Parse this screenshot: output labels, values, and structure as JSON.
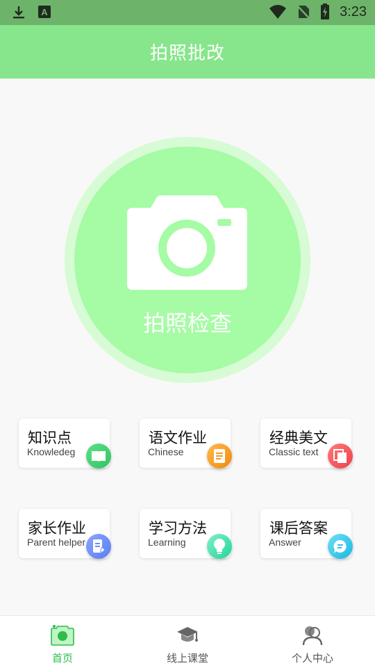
{
  "status_bar": {
    "time": "3:23",
    "icons": [
      "download-icon",
      "a11y-app-icon",
      "wifi-icon",
      "no-sim-icon",
      "battery-charging-icon"
    ]
  },
  "header": {
    "title": "拍照批改"
  },
  "camera": {
    "label": "拍照检查",
    "icon": "camera-icon"
  },
  "cards": [
    {
      "title": "知识点",
      "subtitle": "Knowledeg",
      "icon": "book-icon",
      "color": "#3ecf6a"
    },
    {
      "title": "语文作业",
      "subtitle": "Chinese",
      "icon": "note-icon",
      "color": "#f59a1b"
    },
    {
      "title": "经典美文",
      "subtitle": "Classic text",
      "icon": "documents-icon",
      "color": "#f2555b"
    },
    {
      "title": "家长作业",
      "subtitle": "Parent helper",
      "icon": "edit-doc-icon",
      "color": "#6a8cf7"
    },
    {
      "title": "学习方法",
      "subtitle": "Learning",
      "icon": "lightbulb-icon",
      "color": "#3fe3b0"
    },
    {
      "title": "课后答案",
      "subtitle": "Answer",
      "icon": "chat-icon",
      "color": "#28c6e8"
    }
  ],
  "nav": [
    {
      "label": "首页",
      "icon": "camera-icon",
      "active": true,
      "color": "#2ebd4a"
    },
    {
      "label": "线上课堂",
      "icon": "graduation-cap-icon",
      "active": false,
      "color": "#555555"
    },
    {
      "label": "个人中心",
      "icon": "user-icon",
      "active": false,
      "color": "#555555"
    }
  ],
  "colors": {
    "status_bar": "#6db36a",
    "header": "#87e58b",
    "camera_outer": "#d7fbd4",
    "camera_inner": "#a6fba5"
  }
}
